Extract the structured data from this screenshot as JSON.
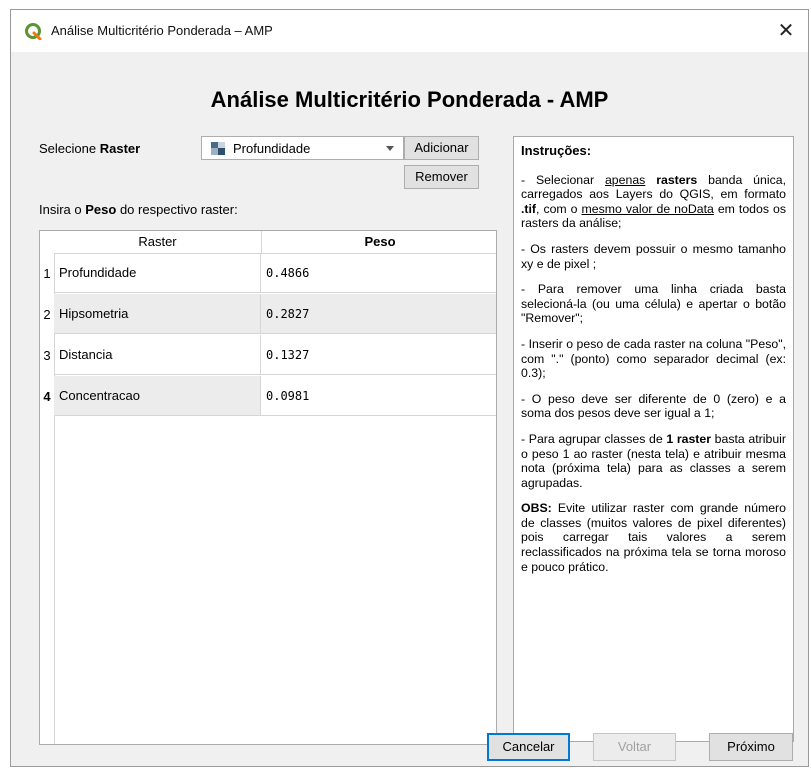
{
  "window": {
    "title": "Análise Multicritério Ponderada – AMP",
    "close_glyph": "✕"
  },
  "heading": "Análise Multicritério Ponderada - AMP",
  "select_raster": {
    "label_pre": "Selecione ",
    "label_bold": "Raster",
    "value": "Profundidade",
    "add_label": "Adicionar",
    "remove_label": "Remover"
  },
  "weight_prompt": {
    "pre": "Insira o ",
    "bold": "Peso",
    "post": " do respectivo raster:"
  },
  "table": {
    "headers": [
      "Raster",
      "Peso"
    ],
    "rows": [
      {
        "num": "1",
        "raster": "Profundidade",
        "peso": "0.4866"
      },
      {
        "num": "2",
        "raster": "Hipsometria",
        "peso": "0.2827"
      },
      {
        "num": "3",
        "raster": "Distancia",
        "peso": "0.1327"
      },
      {
        "num": "4",
        "raster": "Concentracao",
        "peso": "0.0981"
      }
    ]
  },
  "instructions": {
    "title": "Instruções:",
    "p1": {
      "a": "- Selecionar ",
      "b": "apenas",
      "c": " ",
      "d": "rasters",
      "e": " banda única, carregados aos Layers do QGIS, em formato ",
      "f": ".tif",
      "g": ", com o ",
      "h": "mesmo valor de noData",
      "i": " em todos os rasters da análise;"
    },
    "p2": "- Os rasters devem possuir o mesmo tamanho xy e de pixel ;",
    "p3": "- Para remover uma linha criada basta selecioná-la (ou uma célula) e apertar o botão \"Remover\";",
    "p4": "- Inserir o peso de cada raster na coluna \"Peso\", com \".\" (ponto) como separador decimal (ex: 0.3);",
    "p5": "- O peso deve ser diferente de 0 (zero) e a soma dos pesos deve ser igual a 1;",
    "p6": {
      "a": "- Para agrupar classes de ",
      "b": "1 raster",
      "c": " basta atribuir o peso 1 ao raster (nesta tela) e atribuir mesma nota (próxima tela) para as classes a serem agrupadas."
    },
    "p7": {
      "a": "OBS:",
      "b": " Evite utilizar raster com grande número de classes (muitos valores de pixel diferentes) pois carregar tais valores a serem reclassificados na próxima tela se torna moroso e pouco prático."
    }
  },
  "footer": {
    "cancel": "Cancelar",
    "back": "Voltar",
    "next": "Próximo"
  }
}
